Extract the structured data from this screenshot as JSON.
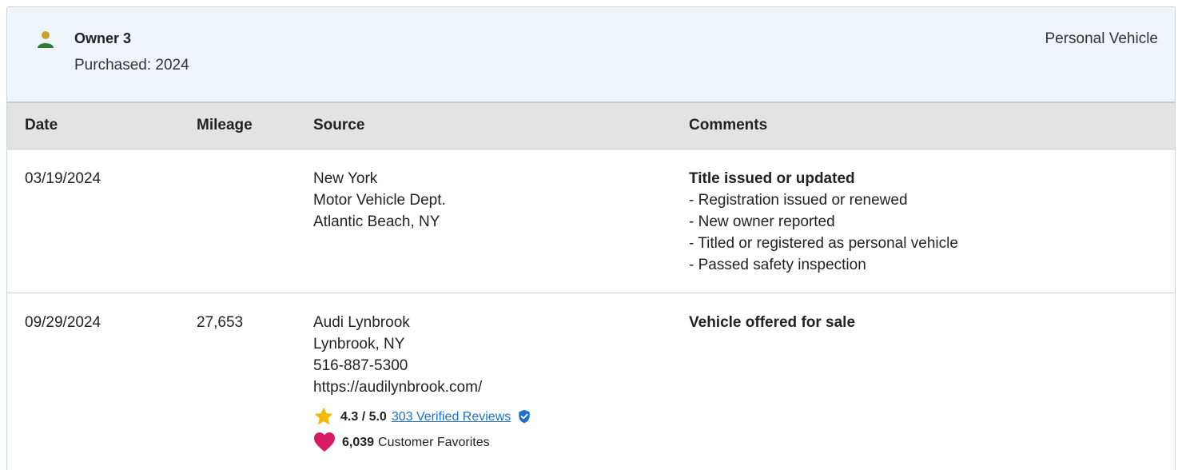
{
  "owner": {
    "name": "Owner 3",
    "purchased": "Purchased: 2024",
    "type": "Personal Vehicle"
  },
  "table": {
    "headers": {
      "date": "Date",
      "mileage": "Mileage",
      "source": "Source",
      "comments": "Comments"
    },
    "rows": [
      {
        "date": "03/19/2024",
        "mileage": "",
        "source": [
          "New York",
          "Motor Vehicle Dept.",
          "Atlantic Beach, NY"
        ],
        "comment_title": "Title issued or updated",
        "comment_items": [
          "Registration issued or renewed",
          "New owner reported",
          "Titled or registered as personal vehicle",
          "Passed safety inspection"
        ]
      },
      {
        "date": "09/29/2024",
        "mileage": "27,653",
        "source": [
          "Audi Lynbrook",
          "Lynbrook, NY",
          "516-887-5300",
          "https://audilynbrook.com/"
        ],
        "rating": "4.3 / 5.0",
        "reviews_link": "303 Verified Reviews",
        "favorites_count": "6,039",
        "favorites_label": "Customer Favorites",
        "comment_title": "Vehicle offered for sale"
      }
    ]
  },
  "colors": {
    "header_bg": "#eef4fa",
    "table_head_bg": "#e3e3e3",
    "link": "#1f6fd1",
    "owner_icon_head": "#c9a227",
    "owner_icon_body": "#2e7d32",
    "star": "#f5b800",
    "heart": "#d81b60",
    "verified": "#1f6fd1"
  }
}
